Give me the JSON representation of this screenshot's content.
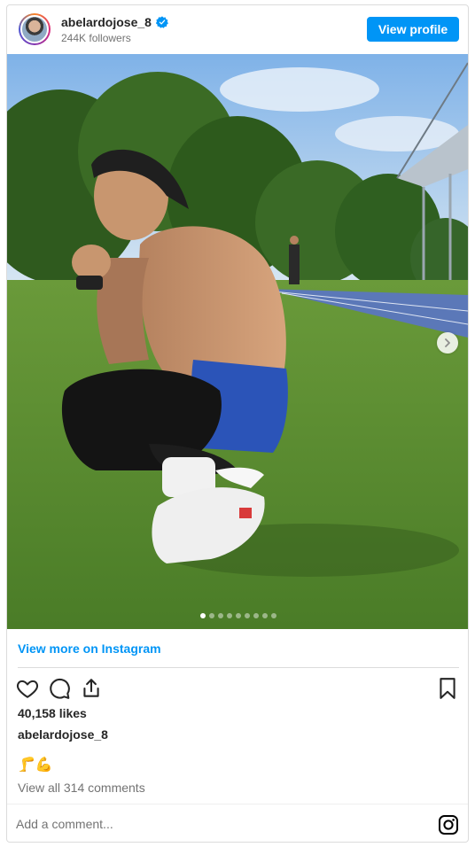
{
  "header": {
    "username": "abelardojose_8",
    "followers": "244K followers",
    "view_profile_label": "View profile",
    "verified_icon": "verified-badge-icon"
  },
  "media": {
    "slide_count": 9,
    "active_slide": 1,
    "next_icon": "chevron-right-icon"
  },
  "footer": {
    "view_more_label": "View more on Instagram",
    "actions": [
      "heart-icon",
      "comment-icon",
      "share-icon",
      "bookmark-icon"
    ],
    "likes": "40,158 likes",
    "owner": "abelardojose_8",
    "caption": "🦵💪",
    "view_comments": "View all 314 comments",
    "comment_placeholder": "Add a comment...",
    "brand_icon": "instagram-icon"
  },
  "colors": {
    "accent": "#0095f6",
    "text": "#262626",
    "muted": "#737373",
    "border": "#dbdbdb"
  }
}
